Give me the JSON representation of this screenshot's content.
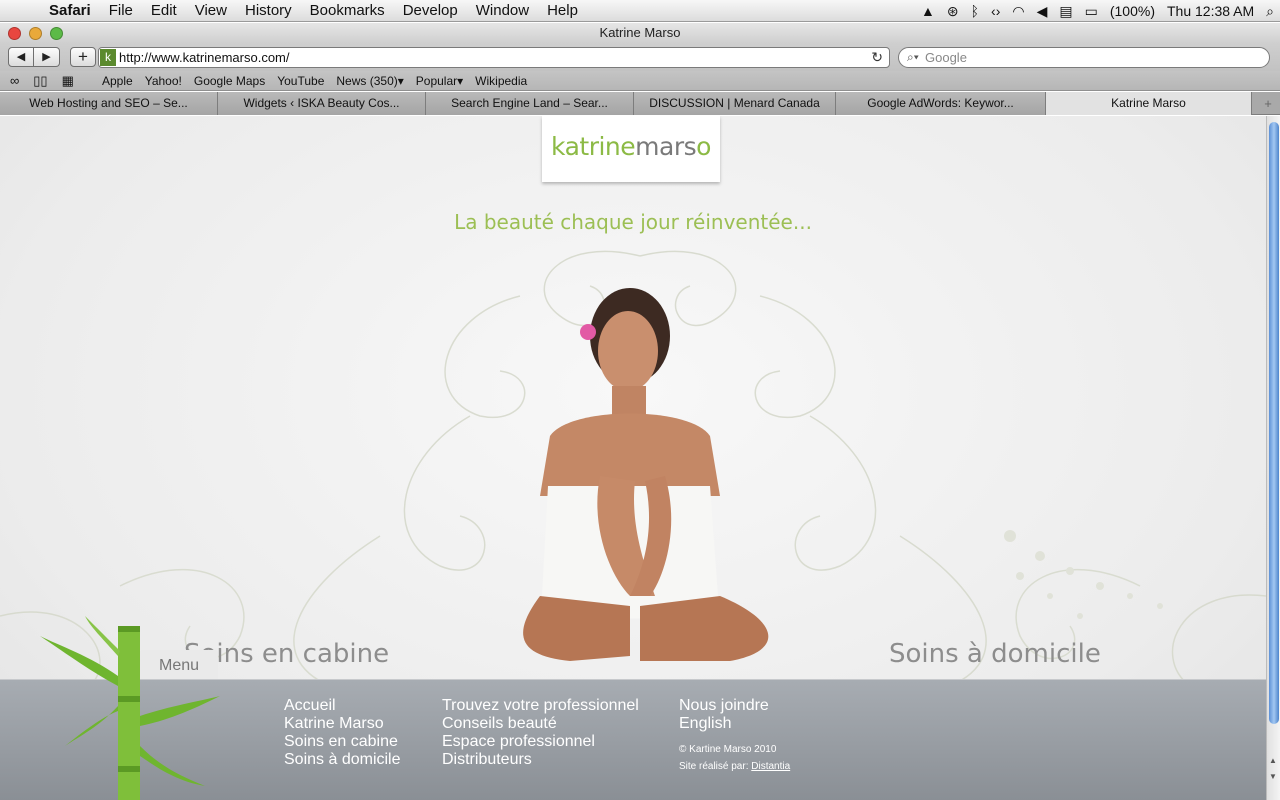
{
  "menubar": {
    "app": "Safari",
    "items": [
      "File",
      "Edit",
      "View",
      "History",
      "Bookmarks",
      "Develop",
      "Window",
      "Help"
    ],
    "battery": "(100%)",
    "clock": "Thu 12:38 AM"
  },
  "window": {
    "title": "Katrine Marso"
  },
  "toolbar": {
    "back_label": "◀",
    "forward_label": "▶",
    "add_label": "+",
    "favicon_letter": "k",
    "url": "http://www.katrinemarso.com/",
    "search_placeholder": "Google"
  },
  "bookmarks": [
    "Apple",
    "Yahoo!",
    "Google Maps",
    "YouTube",
    "News (350)▾",
    "Popular▾",
    "Wikipedia"
  ],
  "tabs": [
    "Web Hosting and SEO – Se...",
    "Widgets ‹ ISKA Beauty Cos...",
    "Search Engine Land – Sear...",
    "DISCUSSION | Menard Canada",
    "Google AdWords: Keywor...",
    "Katrine Marso"
  ],
  "page": {
    "logo_green": "katrine",
    "logo_grey": "mars",
    "logo_end": "o",
    "tagline": "La beauté chaque jour réinventée...",
    "category_left": "Soins en cabine",
    "category_right": "Soins à domicile",
    "menu_tab": "Menu",
    "footer_col1": [
      "Accueil",
      "Katrine Marso",
      "Soins en cabine",
      "Soins à domicile"
    ],
    "footer_col2": [
      "Trouvez votre professionnel",
      "Conseils beauté",
      "Espace professionnel",
      "Distributeurs"
    ],
    "footer_col3": [
      "Nous joindre",
      "English"
    ],
    "copyright": "© Kartine Marso 2010",
    "credit_prefix": "Site réalisé par:",
    "credit_link": "Distantia"
  },
  "colors": {
    "brand_green": "#8cba45",
    "footer_bg": "#969ba1",
    "scroll_thumb": "#5d91d6"
  }
}
